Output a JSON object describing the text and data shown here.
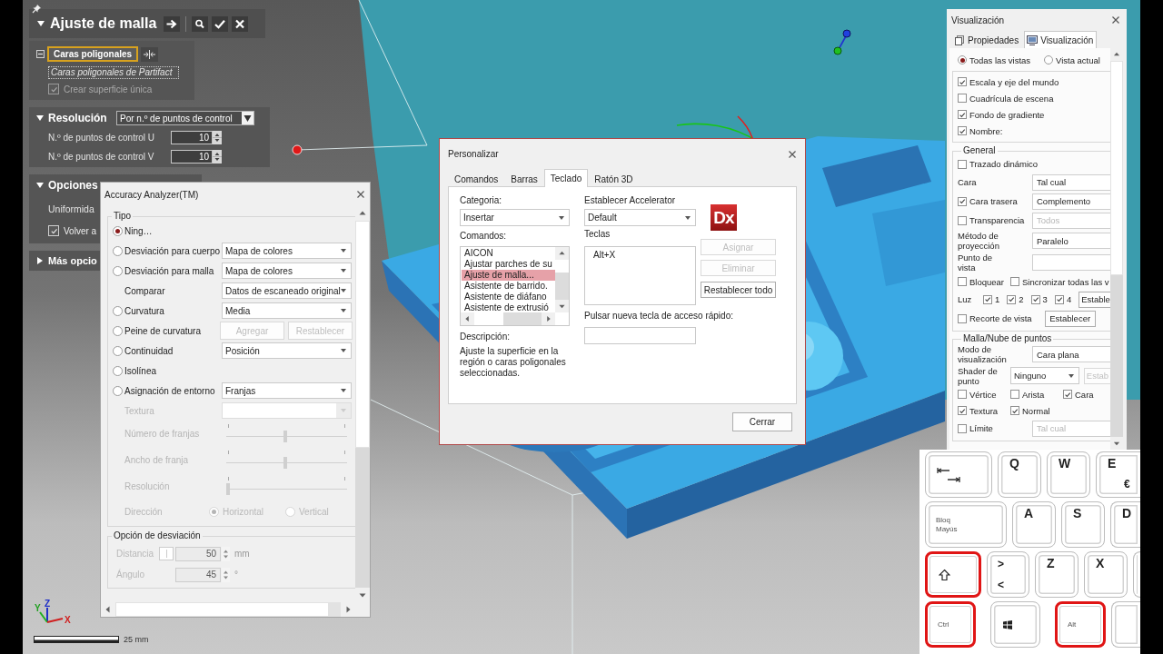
{
  "viewport": {
    "axis_labels": {
      "x": "X",
      "y": "Y",
      "z": "Z"
    },
    "scale": "25 mm"
  },
  "mesh_fit": {
    "title": "Ajuste de malla",
    "faces": {
      "expanded": true,
      "selector": {
        "label": "Caras poligonales",
        "selected": true
      },
      "value": "Caras poligonales de Partifact",
      "single_surface": {
        "label": "Crear superficie única",
        "checked": true,
        "disabled": true
      }
    },
    "resolution": {
      "title": "Resolución",
      "expanded": true,
      "method": "Por n.º de puntos de control",
      "fields": [
        {
          "label": "N.º de puntos de control U",
          "value": "10"
        },
        {
          "label": "N.º de puntos de control V",
          "value": "10"
        }
      ]
    },
    "options": {
      "title": "Opciones",
      "expanded": true,
      "label": "Uniformida",
      "return": {
        "label": "Volver a",
        "checked": true
      }
    },
    "more": {
      "title": "Más opcio",
      "expanded": false
    }
  },
  "analyzer": {
    "title": "Accuracy Analyzer(TM)",
    "type_group": {
      "title": "Tipo",
      "rows": [
        {
          "kind": "radio",
          "label": "Ning…",
          "selected": true,
          "disabled": false
        },
        {
          "kind": "radio",
          "label": "Desviación para cuerpo",
          "selected": false,
          "disabled": false,
          "select": "Mapa de colores"
        },
        {
          "kind": "radio",
          "label": "Desviación para malla",
          "selected": false,
          "disabled": false,
          "select": "Mapa de colores"
        },
        {
          "kind": "label",
          "label": "Comparar",
          "disabled": false,
          "select": "Datos de escaneado original"
        },
        {
          "kind": "radio",
          "label": "Curvatura",
          "selected": false,
          "disabled": false,
          "select": "Media"
        },
        {
          "kind": "radio",
          "label": "Peine de curvatura",
          "selected": false,
          "disabled": false,
          "buttons": [
            {
              "label": "Agregar",
              "disabled": true
            },
            {
              "label": "Restablecer",
              "disabled": true
            }
          ]
        },
        {
          "kind": "radio",
          "label": "Continuidad",
          "selected": false,
          "disabled": false,
          "select": "Posición"
        },
        {
          "kind": "radio",
          "label": "Isolínea",
          "selected": false,
          "disabled": false
        },
        {
          "kind": "radio",
          "label": "Asignación de entorno",
          "selected": false,
          "disabled": false,
          "select": "Franjas"
        },
        {
          "kind": "empty-select",
          "label": "Textura",
          "disabled": true
        },
        {
          "kind": "slider",
          "label": "Número de franjas",
          "disabled": true,
          "level": 0.49
        },
        {
          "kind": "slider",
          "label": "Ancho de franja",
          "disabled": true,
          "level": 0.49
        },
        {
          "kind": "slider",
          "label": "Resolución",
          "disabled": true,
          "level": 0
        },
        {
          "kind": "choice",
          "label": "Dirección",
          "disabled": true,
          "choices": [
            {
              "label": "Horizontal",
              "selected": true
            },
            {
              "label": "Vertical",
              "selected": false
            }
          ]
        }
      ]
    },
    "deviation_group": {
      "title": "Opción de desviación",
      "fields": [
        {
          "kind": "toggle-number",
          "label": "Distancia",
          "value": "50",
          "unit": "mm",
          "disabled": true
        },
        {
          "kind": "number",
          "label": "Ángulo",
          "value": "45",
          "unit": "°",
          "disabled": true
        }
      ]
    }
  },
  "customize": {
    "title": "Personalizar",
    "tabs": [
      {
        "label": "Comandos",
        "selected": false
      },
      {
        "label": "Barras",
        "selected": false
      },
      {
        "label": "Teclado",
        "selected": true
      },
      {
        "label": "Ratón 3D",
        "selected": false
      }
    ],
    "category": {
      "label": "Categoria:",
      "value": "Insertar"
    },
    "commands": {
      "label": "Comandos:",
      "items": [
        {
          "label": "AICON",
          "selected": false
        },
        {
          "label": "Ajustar parches de su",
          "selected": false
        },
        {
          "label": "Ajuste de malla...",
          "selected": true
        },
        {
          "label": "Asistente de barrido.",
          "selected": false
        },
        {
          "label": "Asistente de diáfano",
          "selected": false
        },
        {
          "label": "Asistente de extrusió",
          "selected": false
        }
      ]
    },
    "description": {
      "label": "Descripción:",
      "text": "Ajuste la superficie en la región o caras poligonales seleccionadas."
    },
    "accelerator": {
      "label": "Establecer Accelerator",
      "value": "Default"
    },
    "keys": {
      "label": "Teclas",
      "items": [
        "Alt+X"
      ]
    },
    "logo": "Dx",
    "buttons": [
      {
        "label": "Asignar",
        "disabled": true
      },
      {
        "label": "Eliminar",
        "disabled": true
      },
      {
        "label": "Restablecer todo",
        "disabled": false
      }
    ],
    "shortcut": {
      "label": "Pulsar nueva tecla de acceso rápido:"
    },
    "close": "Cerrar"
  },
  "display": {
    "title": "Visualización",
    "tabs": [
      {
        "label": "Propiedades",
        "selected": false
      },
      {
        "label": "Visualización",
        "selected": true
      }
    ],
    "scope": [
      {
        "label": "Todas las vistas",
        "selected": true
      },
      {
        "label": "Vista actual",
        "selected": false
      }
    ],
    "world": [
      {
        "label": "Escala y eje del mundo",
        "checked": true
      },
      {
        "label": "Cuadrícula de escena",
        "checked": false
      },
      {
        "label": "Fondo de gradiente",
        "checked": true
      },
      {
        "label": "Nombre:",
        "checked": true
      }
    ],
    "general": {
      "title": "General",
      "rows": [
        {
          "kind": "check",
          "label": "Trazado dinámico",
          "checked": false
        },
        {
          "kind": "field",
          "label": "Cara",
          "value": "Tal cual"
        },
        {
          "kind": "check-field",
          "label": "Cara trasera",
          "checked": true,
          "value": "Complemento"
        },
        {
          "kind": "check-field",
          "label": "Transparencia",
          "checked": false,
          "value": "Todos"
        },
        {
          "kind": "field",
          "label": "Método de proyección",
          "value": "Paralelo"
        },
        {
          "kind": "field",
          "label": "Punto de vista"
        },
        {
          "kind": "checks",
          "items": [
            {
              "label": "Bloquear",
              "checked": false
            },
            {
              "label": "Sincronizar todas las v",
              "checked": false
            }
          ]
        },
        {
          "kind": "lights",
          "label": "Luz",
          "items": [
            {
              "label": "1",
              "checked": true
            },
            {
              "label": "2",
              "checked": true
            },
            {
              "label": "3",
              "checked": true
            },
            {
              "label": "4",
              "checked": true
            }
          ],
          "button": "Estable"
        },
        {
          "kind": "check-button",
          "label": "Recorte de vista",
          "checked": false,
          "button": "Establecer"
        }
      ]
    },
    "mesh": {
      "title": "Malla/Nube de puntos",
      "rows": [
        {
          "kind": "field",
          "label": "Modo de visualización",
          "value": "Cara plana"
        },
        {
          "kind": "select-button",
          "label": "Shader de punto",
          "value": "Ninguno",
          "button": "Estab",
          "button_disabled": true
        },
        {
          "kind": "checks",
          "items": [
            {
              "label": "Vértice",
              "checked": false
            },
            {
              "label": "Arista",
              "checked": false
            },
            {
              "label": "Cara",
              "checked": true
            }
          ]
        },
        {
          "kind": "checks",
          "items": [
            {
              "label": "Textura",
              "checked": true
            },
            {
              "label": "Normal",
              "checked": true
            }
          ]
        },
        {
          "kind": "check-field",
          "label": "Límite",
          "checked": false,
          "value": "Tal cual"
        }
      ]
    }
  },
  "keyboard": {
    "rows": [
      {
        "keys": [
          {
            "kind": "tab",
            "highlighted": false
          },
          {
            "kind": "char",
            "label": "Q",
            "highlighted": false
          },
          {
            "kind": "char",
            "label": "W",
            "highlighted": false
          },
          {
            "kind": "char",
            "label": "E",
            "alt": "€",
            "highlighted": false
          }
        ]
      },
      {
        "keys": [
          {
            "kind": "caps",
            "label": "Bloq Mayús",
            "highlighted": false
          },
          {
            "kind": "char",
            "label": "A",
            "highlighted": false
          },
          {
            "kind": "char",
            "label": "S",
            "highlighted": false
          },
          {
            "kind": "char",
            "label": "D",
            "highlighted": false
          }
        ]
      },
      {
        "keys": [
          {
            "kind": "shift",
            "highlighted": true
          },
          {
            "kind": "stack",
            "label": ">",
            "alt": "<",
            "highlighted": false
          },
          {
            "kind": "char",
            "label": "Z",
            "highlighted": false
          },
          {
            "kind": "char",
            "label": "X",
            "highlighted": false
          },
          {
            "kind": "blank",
            "highlighted": false
          }
        ]
      },
      {
        "keys": [
          {
            "kind": "mod",
            "label": "Ctrl",
            "highlighted": true
          },
          {
            "kind": "windows",
            "highlighted": false
          },
          {
            "kind": "mod",
            "label": "Alt",
            "highlighted": true
          },
          {
            "kind": "blank",
            "highlighted": false
          }
        ]
      }
    ]
  }
}
